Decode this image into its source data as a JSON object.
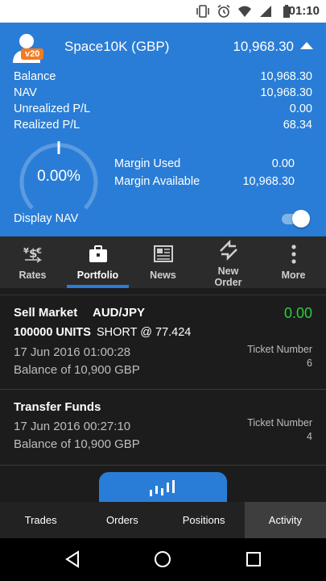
{
  "status_bar": {
    "time": "01:10",
    "icons": [
      "vibrate-icon",
      "alarm-icon",
      "wifi-icon",
      "cell-signal-icon",
      "battery-icon"
    ]
  },
  "account": {
    "version_badge": "v20",
    "name": "Space10K (GBP)",
    "total": "10,968.30",
    "stats": [
      {
        "label": "Balance",
        "value": "10,968.30"
      },
      {
        "label": "NAV",
        "value": "10,968.30"
      },
      {
        "label": "Unrealized P/L",
        "value": "0.00"
      },
      {
        "label": "Realized P/L",
        "value": "68.34"
      }
    ],
    "margin_percent_text": "0.00%",
    "margin_percent": 0,
    "margin_used_label": "Margin Used",
    "margin_used": "0.00",
    "margin_available_label": "Margin Available",
    "margin_available": "10,968.30",
    "display_nav_label": "Display NAV",
    "display_nav_on": true
  },
  "nav": {
    "items": [
      {
        "label": "Rates",
        "icon": "rates-icon"
      },
      {
        "label": "Portfolio",
        "icon": "briefcase-icon",
        "active": true
      },
      {
        "label": "News",
        "icon": "newspaper-icon"
      },
      {
        "label_line1": "New",
        "label_line2": "Order",
        "icon": "new-order-icon"
      },
      {
        "label": "More",
        "icon": "more-vertical-icon"
      }
    ]
  },
  "transactions": [
    {
      "type": "Sell Market",
      "pair": "AUD/JPY",
      "amount": "0.00",
      "units": "100000 UNITS",
      "side": "SHORT @ 77.424",
      "datetime": "17 Jun 2016 01:00:28",
      "balance": "Balance of 10,900 GBP",
      "ticket_label": "Ticket Number",
      "ticket_number": "6"
    },
    {
      "type": "Transfer Funds",
      "datetime": "17 Jun 2016 00:27:10",
      "balance": "Balance of 10,900 GBP",
      "ticket_label": "Ticket Number",
      "ticket_number": "4"
    }
  ],
  "bottom_tabs": [
    {
      "label": "Trades"
    },
    {
      "label": "Orders"
    },
    {
      "label": "Positions"
    },
    {
      "label": "Activity",
      "active": true
    }
  ],
  "colors": {
    "accent": "#2a7dd6",
    "badge": "#f47b20",
    "profit": "#2ecc40",
    "dark_bg": "#1c1c1c"
  }
}
